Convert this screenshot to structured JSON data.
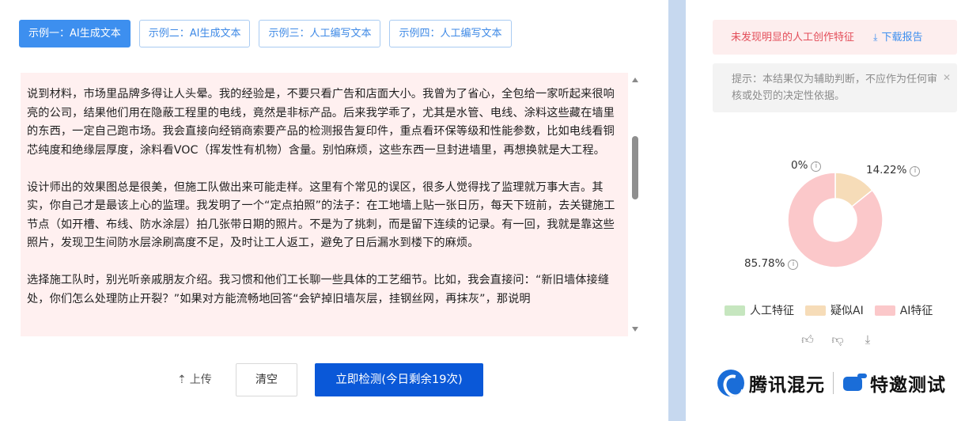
{
  "tabs": [
    {
      "label": "示例一：AI生成文本",
      "active": true
    },
    {
      "label": "示例二：AI生成文本",
      "active": false
    },
    {
      "label": "示例三：人工编写文本",
      "active": false
    },
    {
      "label": "示例四：人工编写文本",
      "active": false
    }
  ],
  "text": {
    "paragraphs": [
      "说到材料，市场里品牌多得让人头晕。我的经验是，不要只看广告和店面大小。我曾为了省心，全包给一家听起来很响亮的公司，结果他们用在隐蔽工程里的电线，竟然是非标产品。后来我学乖了，尤其是水管、电线、涂料这些藏在墙里的东西，一定自己跑市场。我会直接向经销商索要产品的检测报告复印件，重点看环保等级和性能参数，比如电线看铜芯纯度和绝缘层厚度，涂料看VOC（挥发性有机物）含量。别怕麻烦，这些东西一旦封进墙里，再想换就是大工程。",
      "设计师出的效果图总是很美，但施工队做出来可能走样。这里有个常见的误区，很多人觉得找了监理就万事大吉。其实，你自己才是最该上心的监理。我发明了一个“定点拍照”的法子：在工地墙上贴一张日历，每天下班前，去关键施工节点（如开槽、布线、防水涂层）拍几张带日期的照片。不是为了挑刺，而是留下连续的记录。有一回，我就是靠这些照片，发现卫生间防水层涂刷高度不足，及时让工人返工，避免了日后漏水到楼下的麻烦。",
      "选择施工队时，别光听亲戚朋友介绍。我习惯和他们工长聊一些具体的工艺细节。比如，我会直接问：“新旧墙体接缝处，你们怎么处理防止开裂？”如果对方能流畅地回答“会铲掉旧墙灰层，挂钢丝网，再抹灰”，那说明"
    ]
  },
  "actions": {
    "upload_label": "上传",
    "clear_label": "清空",
    "detect_label": "立即检测(今日剩余19次)"
  },
  "result": {
    "status_text": "未发现明显的人工创作特征",
    "download_label": "下载报告"
  },
  "tip": {
    "text": "提示：本结果仅为辅助判断，不应作为任何审核或处罚的决定性依据。"
  },
  "chart_data": {
    "type": "pie",
    "donut": true,
    "slices": [
      {
        "name": "人工特征",
        "value": 0,
        "label": "0%",
        "color": "#c6e6bf"
      },
      {
        "name": "疑似AI",
        "value": 14.22,
        "label": "14.22%",
        "color": "#f6dcb8"
      },
      {
        "name": "AI特征",
        "value": 85.78,
        "label": "85.78%",
        "color": "#fbc8ca"
      }
    ],
    "legend": [
      "人工特征",
      "疑似AI",
      "AI特征"
    ],
    "legend_position": "bottom"
  },
  "brand": {
    "name1": "腾讯混元",
    "name2": "特邀测试"
  },
  "colors": {
    "primary": "#3d8fef",
    "detect_button": "#0a58d8",
    "alert_text": "#e34d59",
    "text_bg": "#fff0f0"
  }
}
